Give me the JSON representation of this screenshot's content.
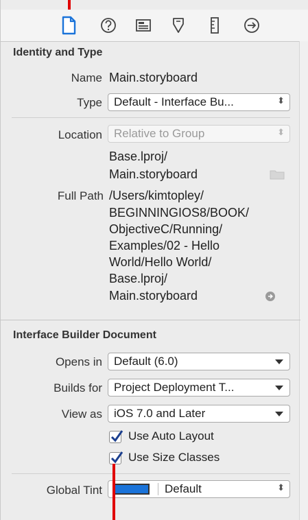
{
  "toolbar": {
    "icons": [
      "file-icon",
      "help-icon",
      "identity-icon",
      "attributes-icon",
      "size-icon",
      "connections-icon"
    ],
    "active_color": "#1a73d9"
  },
  "identity": {
    "title": "Identity and Type",
    "name_label": "Name",
    "name_value": "Main.storyboard",
    "type_label": "Type",
    "type_value": "Default - Interface Bu..."
  },
  "location": {
    "label": "Location",
    "value": "Relative to Group",
    "path_lines": [
      "Base.lproj/",
      "Main.storyboard"
    ]
  },
  "full_path": {
    "label": "Full Path",
    "lines": [
      "/Users/kimtopley/",
      "BEGINNINGIOS8/BOOK/",
      "ObjectiveC/Running/",
      "Examples/02 - Hello",
      "World/Hello World/",
      "Base.lproj/",
      "Main.storyboard"
    ]
  },
  "ib_document": {
    "title": "Interface Builder Document",
    "opens_in_label": "Opens in",
    "opens_in_value": "Default (6.0)",
    "builds_for_label": "Builds for",
    "builds_for_value": "Project Deployment T...",
    "view_as_label": "View as",
    "view_as_value": "iOS 7.0 and Later",
    "use_auto_layout": "Use Auto Layout",
    "use_size_classes": "Use Size Classes",
    "global_tint_label": "Global Tint",
    "global_tint_value": "Default",
    "tint_color": "#1a73d9"
  }
}
